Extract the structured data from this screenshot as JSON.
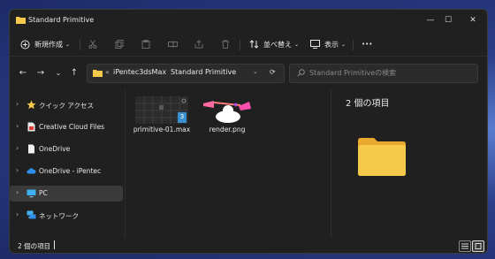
{
  "window": {
    "title": "Standard Primitive",
    "controls": {
      "minimize": "—",
      "maximize": "☐",
      "close": "✕"
    }
  },
  "toolbar": {
    "new_label": "新規作成",
    "sort_label": "並べ替え",
    "view_label": "表示",
    "more_label": "•••"
  },
  "address": {
    "overflow": "«",
    "crumbs": [
      "iPentec3dsMax",
      "Standard Primitive"
    ],
    "separator": "›"
  },
  "search": {
    "placeholder": "Standard Primitiveの検索"
  },
  "nav": {
    "back": "←",
    "forward": "→",
    "recent": "⌄",
    "up": "↑"
  },
  "sidebar": {
    "items": [
      {
        "label": "クイック アクセス",
        "icon": "star-icon",
        "selected": false
      },
      {
        "label": "Creative Cloud Files",
        "icon": "creative-cloud-file-icon",
        "selected": false
      },
      {
        "label": "OneDrive",
        "icon": "document-icon",
        "selected": false
      },
      {
        "label": "OneDrive - iPentec",
        "icon": "cloud-icon",
        "selected": false
      },
      {
        "label": "PC",
        "icon": "monitor-icon",
        "selected": true
      },
      {
        "label": "ネットワーク",
        "icon": "network-icon",
        "selected": false
      }
    ]
  },
  "files": [
    {
      "name": "primitive-01.max",
      "icon": "3dsmax-file-icon",
      "badge": "3"
    },
    {
      "name": "render.png",
      "icon": "image-thumbnail-icon"
    }
  ],
  "details": {
    "count_text": "2 個の項目"
  },
  "status": {
    "count_text": "2 個の項目"
  },
  "colors": {
    "folder_yellow": "#f5c94a",
    "accent_blue": "#4aa3ff",
    "window_bg": "#202020",
    "selection_bg": "#3a3a3a"
  }
}
